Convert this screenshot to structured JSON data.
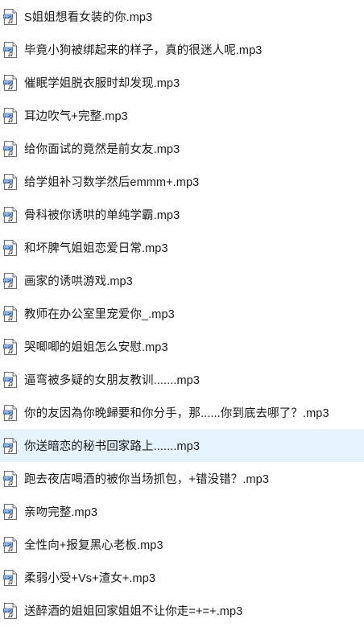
{
  "files": [
    {
      "name": "S姐姐想看女装的你.mp3",
      "icon": "mp3-file-icon"
    },
    {
      "name": "毕竟小狗被绑起来的样子，真的很迷人呢.mp3",
      "icon": "mp3-file-icon"
    },
    {
      "name": "催眠学姐脱衣服时却发现.mp3",
      "icon": "mp3-file-icon"
    },
    {
      "name": "耳边吹气+完整.mp3",
      "icon": "mp3-file-icon"
    },
    {
      "name": "给你面试的竟然是前女友.mp3",
      "icon": "mp3-file-icon"
    },
    {
      "name": "给学姐补习数学然后emmm+.mp3",
      "icon": "mp3-file-icon"
    },
    {
      "name": "骨科被你诱哄的单纯学霸.mp3",
      "icon": "mp3-file-icon"
    },
    {
      "name": "和坏脾气姐姐恋爱日常.mp3",
      "icon": "mp3-file-icon"
    },
    {
      "name": "画家的诱哄游戏.mp3",
      "icon": "mp3-file-icon"
    },
    {
      "name": "教师在办公室里宠爱你_.mp3",
      "icon": "mp3-file-icon"
    },
    {
      "name": "哭唧唧的姐姐怎么安慰.mp3",
      "icon": "mp3-file-icon"
    },
    {
      "name": "逼弯被多疑的女朋友教训.......mp3",
      "icon": "mp3-file-icon"
    },
    {
      "name": "你的友因為你晚歸要和你分手，那......你到底去哪了？.mp3",
      "icon": "mp3-file-icon"
    },
    {
      "name": "你送暗恋的秘书回家路上.......mp3",
      "icon": "mp3-file-icon",
      "selected": true
    },
    {
      "name": "跑去夜店喝酒的被你当场抓包，+错没错？.mp3",
      "icon": "mp3-file-icon"
    },
    {
      "name": "亲吻完整.mp3",
      "icon": "mp3-file-icon"
    },
    {
      "name": "全性向+报复黑心老板.mp3",
      "icon": "mp3-file-icon"
    },
    {
      "name": "柔弱小受+Vs+渣女+.mp3",
      "icon": "mp3-file-icon"
    },
    {
      "name": "送醉酒的姐姐回家姐姐不让你走=+=+.mp3",
      "icon": "mp3-file-icon"
    }
  ],
  "colors": {
    "selected_background": "#e5f3ff",
    "text": "#1a1a1a",
    "icon_label": "#3a6fb0"
  },
  "icon_text": "MP3"
}
